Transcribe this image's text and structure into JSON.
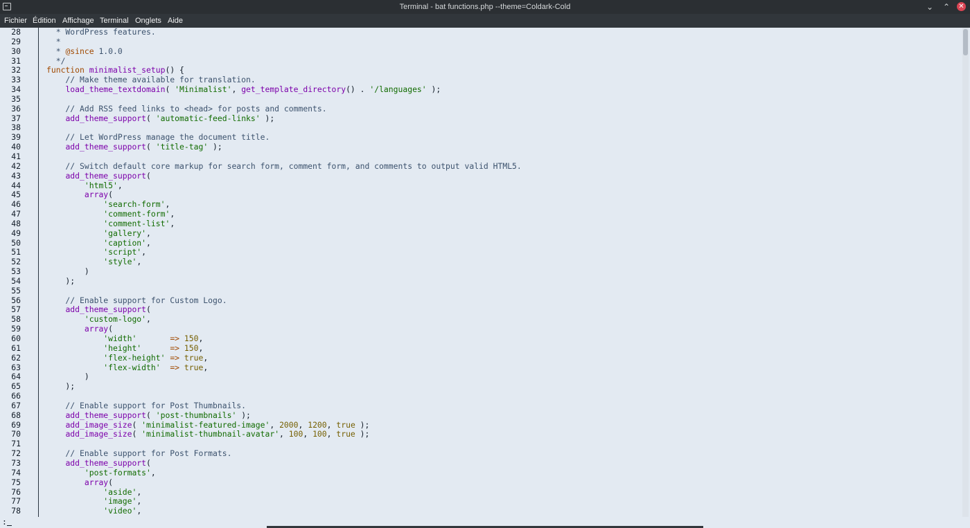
{
  "window": {
    "title": "Terminal - bat functions.php --theme=Coldark-Cold",
    "minimize_glyph": "⌄",
    "maximize_glyph": "⌃",
    "close_glyph": "✕"
  },
  "menu": [
    "Fichier",
    "Édition",
    "Affichage",
    "Terminal",
    "Onglets",
    "Aide"
  ],
  "colors": {
    "background": "#e3eaf2",
    "comment": "#3c526d",
    "string": "#116b00",
    "function": "#7c00aa",
    "keyword": "#a04900",
    "number": "#755f00"
  },
  "prompt": ":",
  "lines": [
    {
      "n": "28",
      "t": [
        [
          "c",
          "  * WordPress features."
        ]
      ]
    },
    {
      "n": "29",
      "t": [
        [
          "c",
          "  *"
        ]
      ]
    },
    {
      "n": "30",
      "t": [
        [
          "c",
          "  * "
        ],
        [
          "k",
          "@since"
        ],
        [
          "c",
          " 1.0.0"
        ]
      ]
    },
    {
      "n": "31",
      "t": [
        [
          "c",
          "  */"
        ]
      ]
    },
    {
      "n": "32",
      "t": [
        [
          "k",
          "function"
        ],
        [
          "p",
          " "
        ],
        [
          "f",
          "minimalist_setup"
        ],
        [
          "p",
          "() {"
        ]
      ]
    },
    {
      "n": "33",
      "t": [
        [
          "c",
          "    // Make theme available for translation."
        ]
      ]
    },
    {
      "n": "34",
      "t": [
        [
          "p",
          "    "
        ],
        [
          "f",
          "load_theme_textdomain"
        ],
        [
          "p",
          "( "
        ],
        [
          "s",
          "'Minimalist'"
        ],
        [
          "p",
          ", "
        ],
        [
          "f",
          "get_template_directory"
        ],
        [
          "p",
          "() . "
        ],
        [
          "s",
          "'/languages'"
        ],
        [
          "p",
          " );"
        ]
      ]
    },
    {
      "n": "35",
      "t": []
    },
    {
      "n": "36",
      "t": [
        [
          "c",
          "    // Add RSS feed links to <head> for posts and comments."
        ]
      ]
    },
    {
      "n": "37",
      "t": [
        [
          "p",
          "    "
        ],
        [
          "f",
          "add_theme_support"
        ],
        [
          "p",
          "( "
        ],
        [
          "s",
          "'automatic-feed-links'"
        ],
        [
          "p",
          " );"
        ]
      ]
    },
    {
      "n": "38",
      "t": []
    },
    {
      "n": "39",
      "t": [
        [
          "c",
          "    // Let WordPress manage the document title."
        ]
      ]
    },
    {
      "n": "40",
      "t": [
        [
          "p",
          "    "
        ],
        [
          "f",
          "add_theme_support"
        ],
        [
          "p",
          "( "
        ],
        [
          "s",
          "'title-tag'"
        ],
        [
          "p",
          " );"
        ]
      ]
    },
    {
      "n": "41",
      "t": []
    },
    {
      "n": "42",
      "t": [
        [
          "c",
          "    // Switch default core markup for search form, comment form, and comments to output valid HTML5."
        ]
      ]
    },
    {
      "n": "43",
      "t": [
        [
          "p",
          "    "
        ],
        [
          "f",
          "add_theme_support"
        ],
        [
          "p",
          "("
        ]
      ]
    },
    {
      "n": "44",
      "t": [
        [
          "p",
          "        "
        ],
        [
          "s",
          "'html5'"
        ],
        [
          "p",
          ","
        ]
      ]
    },
    {
      "n": "45",
      "t": [
        [
          "p",
          "        "
        ],
        [
          "f",
          "array"
        ],
        [
          "p",
          "("
        ]
      ]
    },
    {
      "n": "46",
      "t": [
        [
          "p",
          "            "
        ],
        [
          "s",
          "'search-form'"
        ],
        [
          "p",
          ","
        ]
      ]
    },
    {
      "n": "47",
      "t": [
        [
          "p",
          "            "
        ],
        [
          "s",
          "'comment-form'"
        ],
        [
          "p",
          ","
        ]
      ]
    },
    {
      "n": "48",
      "t": [
        [
          "p",
          "            "
        ],
        [
          "s",
          "'comment-list'"
        ],
        [
          "p",
          ","
        ]
      ]
    },
    {
      "n": "49",
      "t": [
        [
          "p",
          "            "
        ],
        [
          "s",
          "'gallery'"
        ],
        [
          "p",
          ","
        ]
      ]
    },
    {
      "n": "50",
      "t": [
        [
          "p",
          "            "
        ],
        [
          "s",
          "'caption'"
        ],
        [
          "p",
          ","
        ]
      ]
    },
    {
      "n": "51",
      "t": [
        [
          "p",
          "            "
        ],
        [
          "s",
          "'script'"
        ],
        [
          "p",
          ","
        ]
      ]
    },
    {
      "n": "52",
      "t": [
        [
          "p",
          "            "
        ],
        [
          "s",
          "'style'"
        ],
        [
          "p",
          ","
        ]
      ]
    },
    {
      "n": "53",
      "t": [
        [
          "p",
          "        )"
        ]
      ]
    },
    {
      "n": "54",
      "t": [
        [
          "p",
          "    );"
        ]
      ]
    },
    {
      "n": "55",
      "t": []
    },
    {
      "n": "56",
      "t": [
        [
          "c",
          "    // Enable support for Custom Logo."
        ]
      ]
    },
    {
      "n": "57",
      "t": [
        [
          "p",
          "    "
        ],
        [
          "f",
          "add_theme_support"
        ],
        [
          "p",
          "("
        ]
      ]
    },
    {
      "n": "58",
      "t": [
        [
          "p",
          "        "
        ],
        [
          "s",
          "'custom-logo'"
        ],
        [
          "p",
          ","
        ]
      ]
    },
    {
      "n": "59",
      "t": [
        [
          "p",
          "        "
        ],
        [
          "f",
          "array"
        ],
        [
          "p",
          "("
        ]
      ]
    },
    {
      "n": "60",
      "t": [
        [
          "p",
          "            "
        ],
        [
          "s",
          "'width'"
        ],
        [
          "p",
          "       "
        ],
        [
          "k",
          "=>"
        ],
        [
          "p",
          " "
        ],
        [
          "n",
          "150"
        ],
        [
          "p",
          ","
        ]
      ]
    },
    {
      "n": "61",
      "t": [
        [
          "p",
          "            "
        ],
        [
          "s",
          "'height'"
        ],
        [
          "p",
          "      "
        ],
        [
          "k",
          "=>"
        ],
        [
          "p",
          " "
        ],
        [
          "n",
          "150"
        ],
        [
          "p",
          ","
        ]
      ]
    },
    {
      "n": "62",
      "t": [
        [
          "p",
          "            "
        ],
        [
          "s",
          "'flex-height'"
        ],
        [
          "p",
          " "
        ],
        [
          "k",
          "=>"
        ],
        [
          "p",
          " "
        ],
        [
          "n",
          "true"
        ],
        [
          "p",
          ","
        ]
      ]
    },
    {
      "n": "63",
      "t": [
        [
          "p",
          "            "
        ],
        [
          "s",
          "'flex-width'"
        ],
        [
          "p",
          "  "
        ],
        [
          "k",
          "=>"
        ],
        [
          "p",
          " "
        ],
        [
          "n",
          "true"
        ],
        [
          "p",
          ","
        ]
      ]
    },
    {
      "n": "64",
      "t": [
        [
          "p",
          "        )"
        ]
      ]
    },
    {
      "n": "65",
      "t": [
        [
          "p",
          "    );"
        ]
      ]
    },
    {
      "n": "66",
      "t": []
    },
    {
      "n": "67",
      "t": [
        [
          "c",
          "    // Enable support for Post Thumbnails."
        ]
      ]
    },
    {
      "n": "68",
      "t": [
        [
          "p",
          "    "
        ],
        [
          "f",
          "add_theme_support"
        ],
        [
          "p",
          "( "
        ],
        [
          "s",
          "'post-thumbnails'"
        ],
        [
          "p",
          " );"
        ]
      ]
    },
    {
      "n": "69",
      "t": [
        [
          "p",
          "    "
        ],
        [
          "f",
          "add_image_size"
        ],
        [
          "p",
          "( "
        ],
        [
          "s",
          "'minimalist-featured-image'"
        ],
        [
          "p",
          ", "
        ],
        [
          "n",
          "2000"
        ],
        [
          "p",
          ", "
        ],
        [
          "n",
          "1200"
        ],
        [
          "p",
          ", "
        ],
        [
          "n",
          "true"
        ],
        [
          "p",
          " );"
        ]
      ]
    },
    {
      "n": "70",
      "t": [
        [
          "p",
          "    "
        ],
        [
          "f",
          "add_image_size"
        ],
        [
          "p",
          "( "
        ],
        [
          "s",
          "'minimalist-thumbnail-avatar'"
        ],
        [
          "p",
          ", "
        ],
        [
          "n",
          "100"
        ],
        [
          "p",
          ", "
        ],
        [
          "n",
          "100"
        ],
        [
          "p",
          ", "
        ],
        [
          "n",
          "true"
        ],
        [
          "p",
          " );"
        ]
      ]
    },
    {
      "n": "71",
      "t": []
    },
    {
      "n": "72",
      "t": [
        [
          "c",
          "    // Enable support for Post Formats."
        ]
      ]
    },
    {
      "n": "73",
      "t": [
        [
          "p",
          "    "
        ],
        [
          "f",
          "add_theme_support"
        ],
        [
          "p",
          "("
        ]
      ]
    },
    {
      "n": "74",
      "t": [
        [
          "p",
          "        "
        ],
        [
          "s",
          "'post-formats'"
        ],
        [
          "p",
          ","
        ]
      ]
    },
    {
      "n": "75",
      "t": [
        [
          "p",
          "        "
        ],
        [
          "f",
          "array"
        ],
        [
          "p",
          "("
        ]
      ]
    },
    {
      "n": "76",
      "t": [
        [
          "p",
          "            "
        ],
        [
          "s",
          "'aside'"
        ],
        [
          "p",
          ","
        ]
      ]
    },
    {
      "n": "77",
      "t": [
        [
          "p",
          "            "
        ],
        [
          "s",
          "'image'"
        ],
        [
          "p",
          ","
        ]
      ]
    },
    {
      "n": "78",
      "t": [
        [
          "p",
          "            "
        ],
        [
          "s",
          "'video'"
        ],
        [
          "p",
          ","
        ]
      ]
    }
  ]
}
